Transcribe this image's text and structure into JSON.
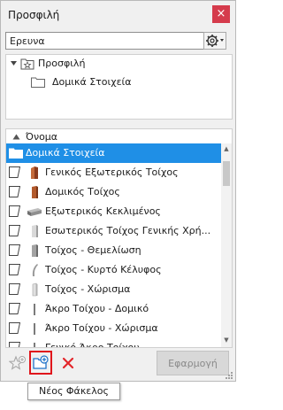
{
  "window": {
    "title": "Προσφιλή",
    "close_glyph": "×"
  },
  "search": {
    "value": "Ερευνα"
  },
  "tree": {
    "root_label": "Προσφιλή",
    "child_label": "Δομικά Στοιχεία"
  },
  "list": {
    "column_header": "Όνομα",
    "rows": [
      {
        "label": "Δομικά Στοιχεία",
        "kind": "folder",
        "selected": true
      },
      {
        "label": "Γενικός Εξωτερικός Τοίχος",
        "icon": "wall-exterior-icon"
      },
      {
        "label": "Δομικός Τοίχος",
        "icon": "wall-structural-icon"
      },
      {
        "label": "Εξωτερικός Κεκλιμένος",
        "icon": "wall-slanted-icon"
      },
      {
        "label": "Εσωτερικός Τοίχος Γενικής Χρή...",
        "icon": "wall-interior-icon"
      },
      {
        "label": "Τοίχος - Θεμελίωση",
        "icon": "wall-foundation-icon"
      },
      {
        "label": "Τοίχος - Κυρτό Κέλυφος",
        "icon": "wall-curved-icon"
      },
      {
        "label": "Τοίχος - Χώρισμα",
        "icon": "wall-partition-icon"
      },
      {
        "label": "Άκρο Τοίχου - Δομικό",
        "icon": "wall-end-icon"
      },
      {
        "label": "Άκρο Τοίχου - Χώρισμα",
        "icon": "wall-end-icon"
      },
      {
        "label": "Γενικό Άκρο Τοίχου",
        "icon": "wall-end-icon"
      }
    ]
  },
  "bottom": {
    "apply_label": "Εφαρμογή",
    "tooltip": "Νέος Φάκελος"
  },
  "colors": {
    "selection": "#1f8fe6",
    "close_button": "#d53b4c",
    "delete_icon": "#e3262b",
    "highlight_box": "#e0161c",
    "new_folder_icon": "#1f73c9"
  }
}
